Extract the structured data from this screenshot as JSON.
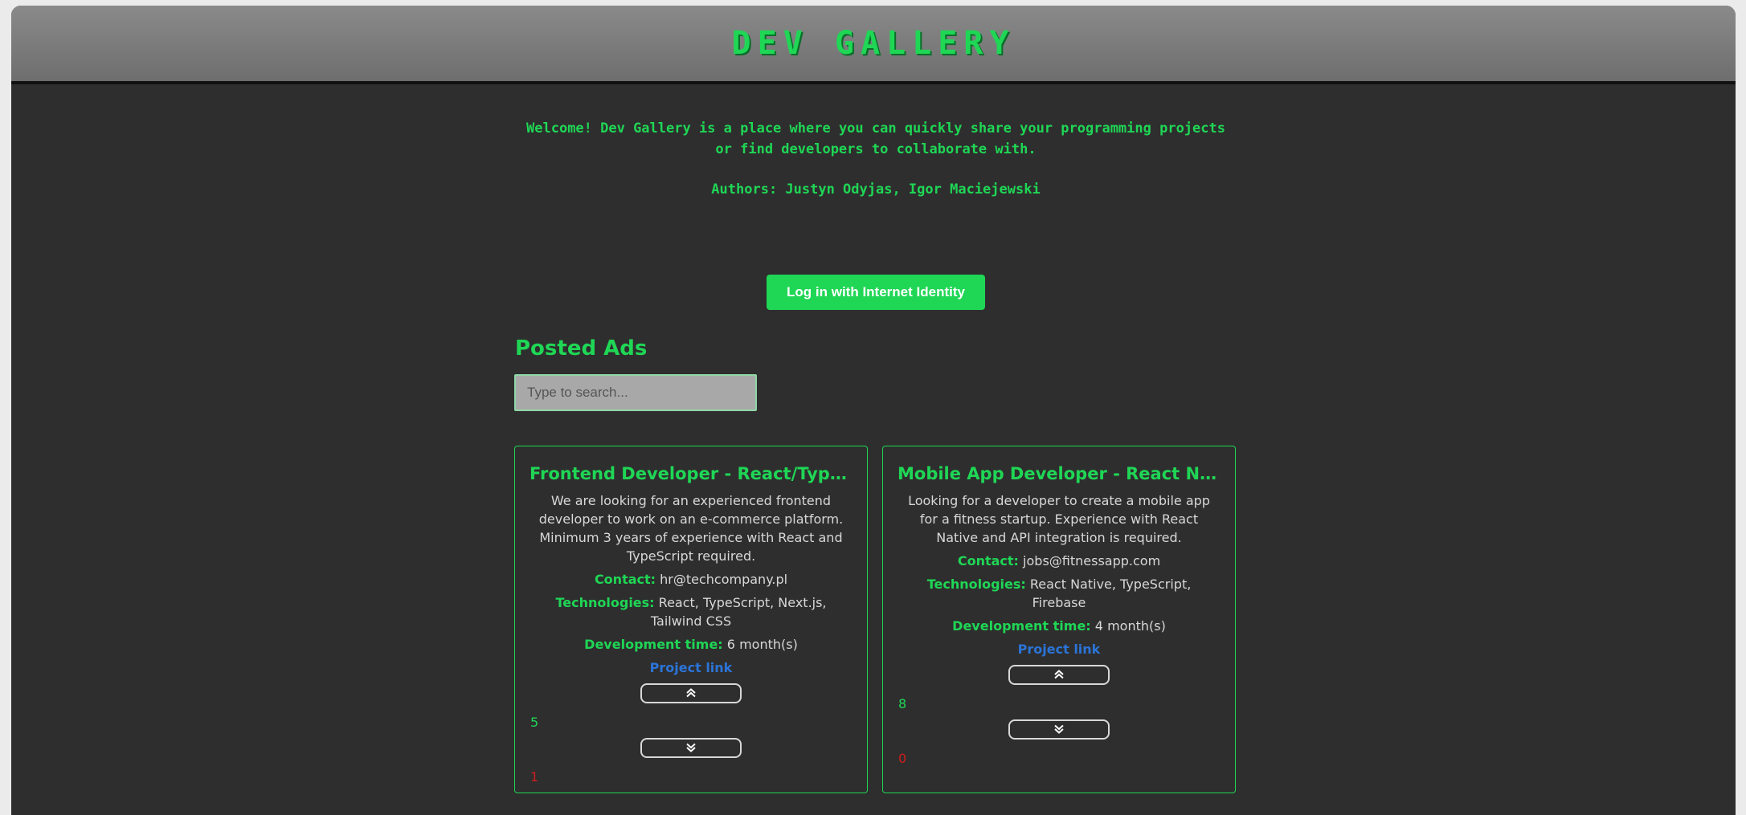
{
  "header": {
    "title": "DEV GALLERY"
  },
  "intro": {
    "welcome": "Welcome! Dev Gallery is a place where you can quickly share your programming projects or find developers to collaborate with.",
    "authors": "Authors: Justyn Odyjas, Igor Maciejewski"
  },
  "login": {
    "label": "Log in with Internet Identity"
  },
  "ads_section": {
    "title": "Posted Ads",
    "search_placeholder": "Type to search..."
  },
  "ads": [
    {
      "title": "Frontend Developer - React/TypeScript",
      "description": "We are looking for an experienced frontend developer to work on an e-commerce platform. Minimum 3 years of experience with React and TypeScript required.",
      "contact_label": "Contact:",
      "contact": "hr@techcompany.pl",
      "technologies_label": "Technologies:",
      "technologies": "React, TypeScript, Next.js, Tailwind CSS",
      "dev_time_label": "Development time:",
      "dev_time": "6 month(s)",
      "project_link": "Project link",
      "upvote_icon": "chevron-double-up-icon",
      "downvote_icon": "chevron-double-down-icon",
      "upvotes": "5",
      "downvotes": "1"
    },
    {
      "title": "Mobile App Developer - React Native",
      "description": "Looking for a developer to create a mobile app for a fitness startup. Experience with React Native and API integration is required.",
      "contact_label": "Contact:",
      "contact": "jobs@fitnessapp.com",
      "technologies_label": "Technologies:",
      "technologies": "React Native, TypeScript, Firebase",
      "dev_time_label": "Development time:",
      "dev_time": "4 month(s)",
      "project_link": "Project link",
      "upvote_icon": "chevron-double-up-icon",
      "downvote_icon": "chevron-double-down-icon",
      "upvotes": "8",
      "downvotes": "0"
    }
  ],
  "colors": {
    "accent": "#1fd655",
    "background": "#2e2e2e",
    "header": "#7a7a7a",
    "link": "#2b74d8",
    "downvote": "#d01d1d"
  }
}
